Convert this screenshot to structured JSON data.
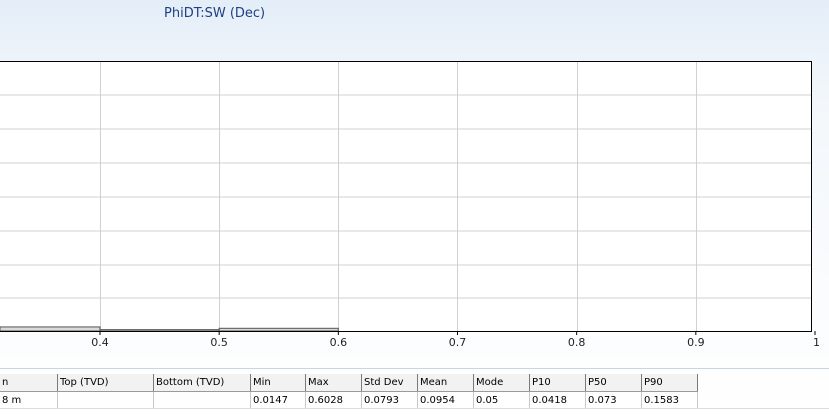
{
  "title": "PhiDT:SW (Dec)",
  "chart_data": {
    "type": "bar",
    "title": "PhiDT:SW (Dec)",
    "xlabel": "",
    "ylabel": "",
    "x_ticks": [
      "0.4",
      "0.5",
      "0.6",
      "0.7",
      "0.8",
      "0.9",
      "1"
    ],
    "xlim": [
      0.3,
      1.0
    ],
    "grid": true,
    "bars": [
      {
        "x0": 0.3,
        "x1": 0.4,
        "value": 0.015
      },
      {
        "x0": 0.4,
        "x1": 0.5,
        "value": 0.005
      },
      {
        "x0": 0.5,
        "x1": 0.6,
        "value": 0.01
      }
    ],
    "ylim": [
      0,
      1
    ]
  },
  "table": {
    "headers": [
      "n",
      "Top (TVD)",
      "Bottom (TVD)",
      "Min",
      "Max",
      "Std Dev",
      "Mean",
      "Mode",
      "P10",
      "P50",
      "P90"
    ],
    "rows": [
      [
        "8 m",
        "",
        "",
        "0.0147",
        "0.6028",
        "0.0793",
        "0.0954",
        "0.05",
        "0.0418",
        "0.073",
        "0.1583"
      ]
    ]
  }
}
